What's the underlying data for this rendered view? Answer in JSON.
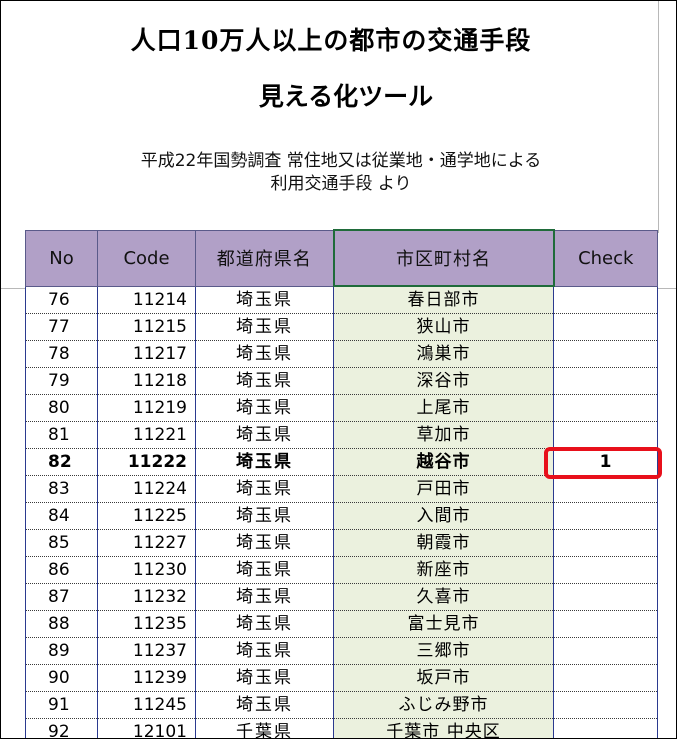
{
  "title": "人口10万人以上の都市の交通手段",
  "subtitle": "見える化ツール",
  "description_line1": "平成22年国勢調査  常住地又は従業地・通学地による",
  "description_line2": "利用交通手段  より",
  "table": {
    "headers": [
      "No",
      "Code",
      "都道府県名",
      "市区町村名",
      "Check"
    ],
    "rows": [
      {
        "no": "76",
        "code": "11214",
        "pref": "埼玉県",
        "city": "春日部市",
        "check": ""
      },
      {
        "no": "77",
        "code": "11215",
        "pref": "埼玉県",
        "city": "狭山市",
        "check": ""
      },
      {
        "no": "78",
        "code": "11217",
        "pref": "埼玉県",
        "city": "鴻巣市",
        "check": ""
      },
      {
        "no": "79",
        "code": "11218",
        "pref": "埼玉県",
        "city": "深谷市",
        "check": ""
      },
      {
        "no": "80",
        "code": "11219",
        "pref": "埼玉県",
        "city": "上尾市",
        "check": ""
      },
      {
        "no": "81",
        "code": "11221",
        "pref": "埼玉県",
        "city": "草加市",
        "check": ""
      },
      {
        "no": "82",
        "code": "11222",
        "pref": "埼玉県",
        "city": "越谷市",
        "check": "1"
      },
      {
        "no": "83",
        "code": "11224",
        "pref": "埼玉県",
        "city": "戸田市",
        "check": ""
      },
      {
        "no": "84",
        "code": "11225",
        "pref": "埼玉県",
        "city": "入間市",
        "check": ""
      },
      {
        "no": "85",
        "code": "11227",
        "pref": "埼玉県",
        "city": "朝霞市",
        "check": ""
      },
      {
        "no": "86",
        "code": "11230",
        "pref": "埼玉県",
        "city": "新座市",
        "check": ""
      },
      {
        "no": "87",
        "code": "11232",
        "pref": "埼玉県",
        "city": "久喜市",
        "check": ""
      },
      {
        "no": "88",
        "code": "11235",
        "pref": "埼玉県",
        "city": "富士見市",
        "check": ""
      },
      {
        "no": "89",
        "code": "11237",
        "pref": "埼玉県",
        "city": "三郷市",
        "check": ""
      },
      {
        "no": "90",
        "code": "11239",
        "pref": "埼玉県",
        "city": "坂戸市",
        "check": ""
      },
      {
        "no": "91",
        "code": "11245",
        "pref": "埼玉県",
        "city": "ふじみ野市",
        "check": ""
      },
      {
        "no": "92",
        "code": "12101",
        "pref": "千葉県",
        "city": "千葉市 中央区",
        "check": ""
      }
    ]
  },
  "colors": {
    "header_bg": "#b1a0c7",
    "city_col_bg": "#ebf1de",
    "highlight_border": "#e8101b"
  }
}
